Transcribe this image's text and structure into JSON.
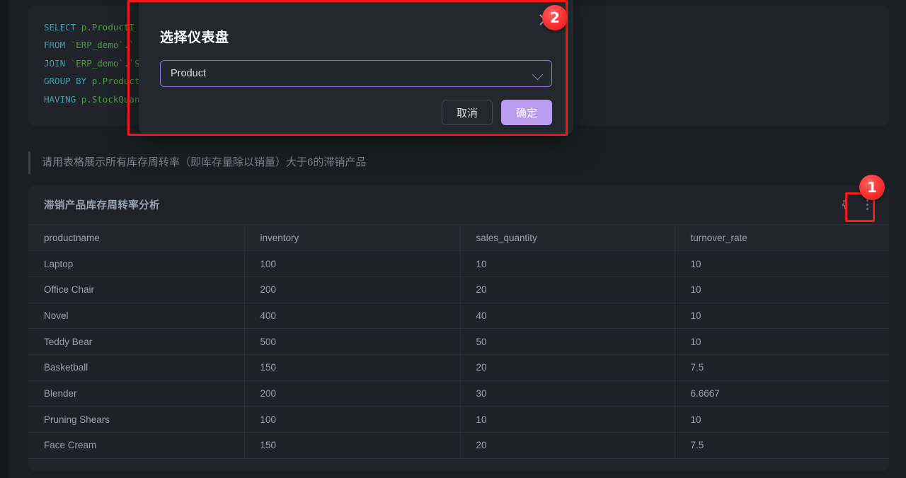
{
  "code_block": {
    "language": "sql",
    "lines": [
      "SELECT p.ProductI",
      "FROM `ERP_demo`.`",
      "JOIN `ERP_demo`.`S",
      "GROUP BY p.Product",
      "HAVING p.StockQuan"
    ]
  },
  "prompt": {
    "text": "请用表格展示所有库存周转率（即库存量除以销量）大于6的滞销产品"
  },
  "result_card": {
    "title": "滞销产品库存周转率分析",
    "actions": {
      "pin": "pin-icon",
      "more": "more-vertical-icon"
    }
  },
  "table": {
    "columns": [
      "productname",
      "inventory",
      "sales_quantity",
      "turnover_rate"
    ],
    "rows": [
      [
        "Laptop",
        "100",
        "10",
        "10"
      ],
      [
        "Office Chair",
        "200",
        "20",
        "10"
      ],
      [
        "Novel",
        "400",
        "40",
        "10"
      ],
      [
        "Teddy Bear",
        "500",
        "50",
        "10"
      ],
      [
        "Basketball",
        "150",
        "20",
        "7.5"
      ],
      [
        "Blender",
        "200",
        "30",
        "6.6667"
      ],
      [
        "Pruning Shears",
        "100",
        "10",
        "10"
      ],
      [
        "Face Cream",
        "150",
        "20",
        "7.5"
      ]
    ]
  },
  "modal": {
    "title": "选择仪表盘",
    "close_icon": "close-icon",
    "select": {
      "value": "Product",
      "chevron_icon": "chevron-down-icon"
    },
    "cancel_label": "取消",
    "confirm_label": "确定"
  },
  "annotations": {
    "badge_1": "1",
    "badge_2": "2",
    "color": "#f81818"
  }
}
